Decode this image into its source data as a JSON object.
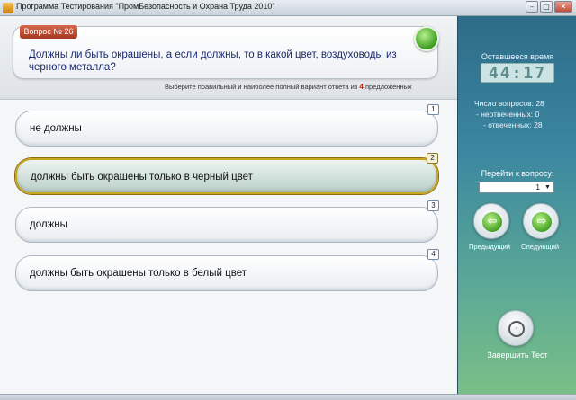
{
  "window": {
    "title": "Программа Тестирования \"ПромБезопасность и Охрана Труда 2010\"",
    "min_glyph": "–",
    "max_glyph": "□",
    "close_glyph": "✕"
  },
  "question": {
    "badge": "Вопрос № 26",
    "text": "Должны ли быть окрашены, а если должны, то в какой цвет, воздуховоды из черного металла?",
    "hint_before": "Выберите правильный и наиболее полный вариант ответа из",
    "hint_count": "4",
    "hint_after": "предложенных"
  },
  "answers": [
    {
      "num": "1",
      "text": "не должны",
      "selected": false
    },
    {
      "num": "2",
      "text": "должны быть окрашены только в черный цвет",
      "selected": true
    },
    {
      "num": "3",
      "text": "должны",
      "selected": false
    },
    {
      "num": "4",
      "text": "должны быть окрашены только в белый цвет",
      "selected": false
    }
  ],
  "sidebar": {
    "time_label": "Оставшееся время",
    "time_value": "44:17",
    "stats": {
      "total": "Число вопросов: 28",
      "unanswered": "- неотвеченных: 0",
      "answered": "- отвеченных: 28"
    },
    "goto_label": "Перейти к вопросу:",
    "goto_value": "1",
    "goto_arrow": "▼",
    "prev_label": "Предыдущий",
    "next_label": "Следующий",
    "prev_glyph": "⇦",
    "next_glyph": "⇨",
    "finish_label": "Завершить Тест",
    "finish_glyph": "◦"
  },
  "icons": {
    "check": "check-icon",
    "prev": "arrow-left-icon",
    "next": "arrow-right-icon",
    "finish": "power-icon"
  },
  "colors": {
    "question_text": "#1a2a6e",
    "badge": "#b34a2f",
    "selected_border": "#c8a624",
    "sidebar_top": "#2e6c88",
    "sidebar_bottom": "#79bf86"
  }
}
